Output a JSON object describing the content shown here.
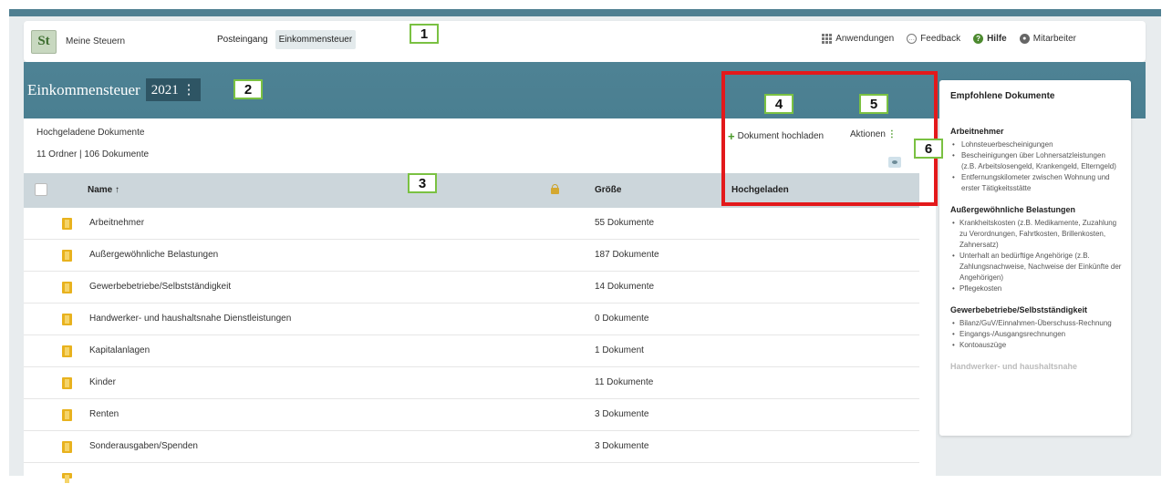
{
  "app": {
    "logo_text": "St",
    "name": "Meine Steuern"
  },
  "topnav": {
    "tabs": [
      {
        "label": "Posteingang"
      },
      {
        "label": "Einkommensteuer"
      }
    ],
    "links": {
      "anwendungen": "Anwendungen",
      "feedback": "Feedback",
      "hilfe": "Hilfe",
      "mitarbeiter": "Mitarbeiter"
    }
  },
  "header": {
    "title": "Einkommensteuer",
    "year": "2021",
    "year_menu_glyph": "⋮"
  },
  "documents": {
    "section_title": "Hochgeladene Dokumente",
    "summary": "11 Ordner | 106 Dokumente",
    "actions": {
      "upload_icon": "+",
      "upload_label": "Dokument hochladen",
      "aktionen_label": "Aktionen",
      "aktionen_glyph": "⋮"
    },
    "table": {
      "col_name": "Name ↑",
      "col_size": "Größe",
      "col_uploaded": "Hochgeladen"
    },
    "rows": [
      {
        "name": "Arbeitnehmer",
        "size": "55 Dokumente"
      },
      {
        "name": "Außergewöhnliche Belastungen",
        "size": "187 Dokumente"
      },
      {
        "name": "Gewerbebetriebe/Selbstständigkeit",
        "size": "14 Dokumente"
      },
      {
        "name": "Handwerker- und haushaltsnahe Dienstleistungen",
        "size": "0 Dokumente"
      },
      {
        "name": "Kapitalanlagen",
        "size": "1 Dokument"
      },
      {
        "name": "Kinder",
        "size": "11 Dokumente"
      },
      {
        "name": "Renten",
        "size": "3 Dokumente"
      },
      {
        "name": "Sonderausgaben/Spenden",
        "size": "3 Dokumente"
      }
    ]
  },
  "recommended": {
    "title": "Empfohlene Dokumente",
    "categories": [
      {
        "title": "Arbeitnehmer",
        "items": [
          "Lohnsteuerbescheinigungen",
          "Bescheinigungen über Lohnersatzleistungen (z.B. Arbeitslosengeld, Krankengeld, Elterngeld)",
          "Entfernungskilometer zwischen Wohnung und erster Tätigkeitsstätte"
        ]
      },
      {
        "title": "Außergewöhnliche Belastungen",
        "items": [
          "Krankheitskosten (z.B. Medikamente, Zuzahlung zu Verordnungen, Fahrtkosten, Brillenkosten, Zahnersatz)",
          "Unterhalt an bedürftige Angehörige (z.B. Zahlungsnachweise, Nachweise der Einkünfte der Angehörigen)",
          "Pflegekosten"
        ]
      },
      {
        "title": "Gewerbebetriebe/Selbstständigkeit",
        "items": [
          "Bilanz/GuV/Einnahmen-Überschuss-Rechnung",
          "Eingangs-/Ausgangsrechnungen",
          "Kontoauszüge"
        ]
      }
    ],
    "cut_off_heading": "Handwerker- und haushaltsnahe"
  },
  "annotations": {
    "badges": [
      "1",
      "2",
      "3",
      "4",
      "5",
      "6"
    ],
    "highlight_color": "#e3191b",
    "badge_border_color": "#7ac142"
  },
  "colors": {
    "header_teal": "#4e8294",
    "year_bg": "#2e5564",
    "table_header": "#ccd6db",
    "accent_green": "#4b9a2a",
    "folder_yellow": "#e8b21e"
  }
}
